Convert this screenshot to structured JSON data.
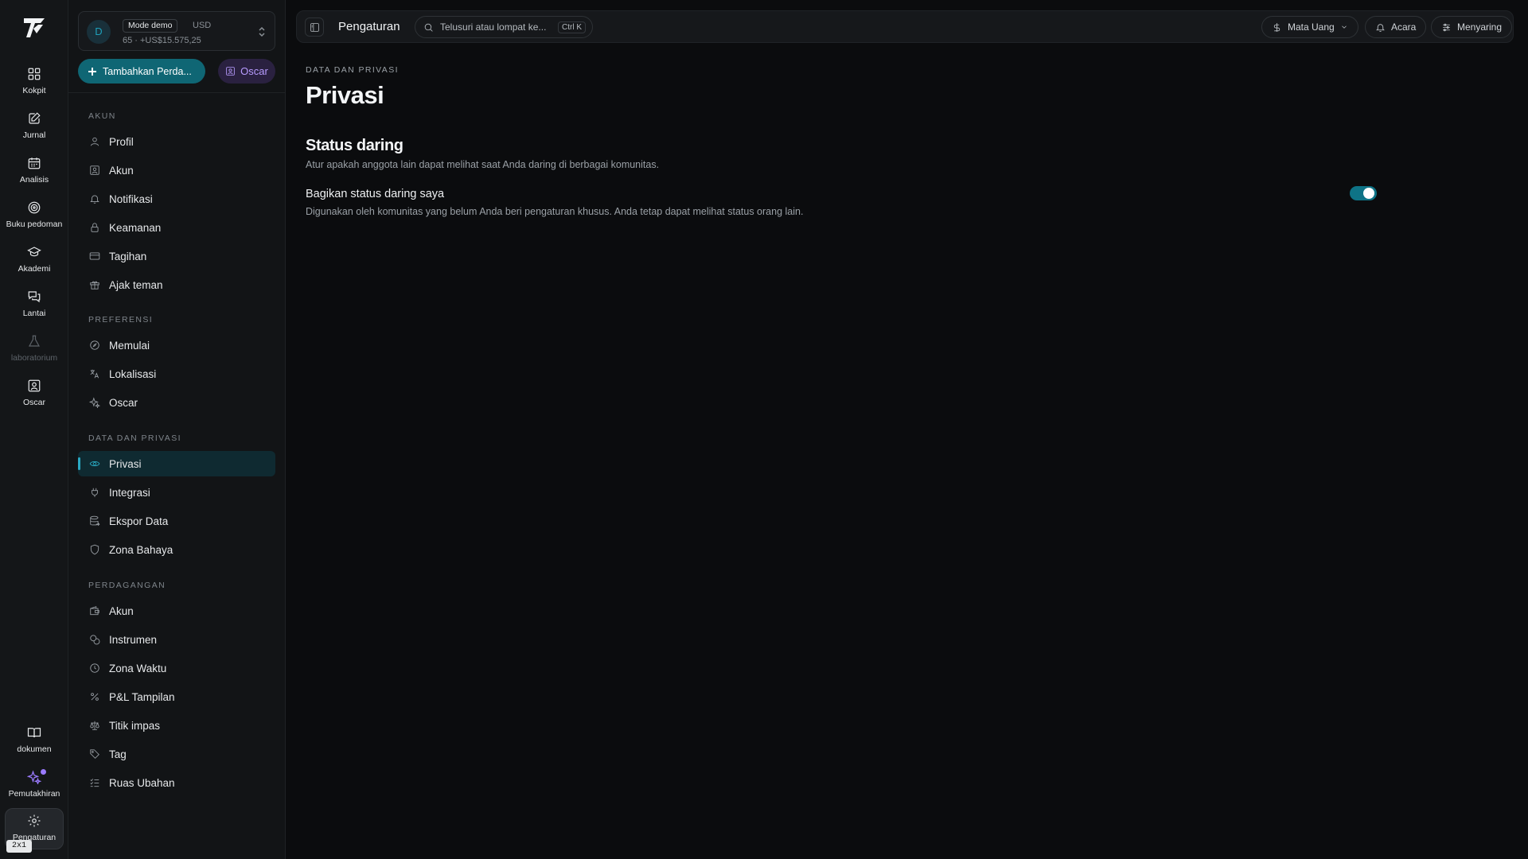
{
  "colors": {
    "accent": "#0f6674",
    "accent_bright": "#2aa8c2",
    "oscar_purple": "#b89cff",
    "background": "#0b0c0e",
    "sidebar": "#121416"
  },
  "rail": {
    "items": [
      {
        "label": "Kokpit",
        "icon": "dashboard-grid-icon"
      },
      {
        "label": "Jurnal",
        "icon": "journal-edit-icon"
      },
      {
        "label": "Analisis",
        "icon": "calendar-analysis-icon"
      },
      {
        "label": "Buku pedoman",
        "icon": "target-icon"
      },
      {
        "label": "Akademi",
        "icon": "graduation-cap-icon"
      },
      {
        "label": "Lantai",
        "icon": "chat-bubbles-icon"
      },
      {
        "label": "laboratorium",
        "icon": "flask-icon"
      },
      {
        "label": "Oscar",
        "icon": "oscar-portrait-icon"
      }
    ],
    "bottom": [
      {
        "label": "dokumen",
        "icon": "book-open-icon"
      },
      {
        "label": "Pemutakhiran",
        "icon": "sparkles-icon"
      },
      {
        "label": "Pengaturan",
        "icon": "gear-icon"
      }
    ],
    "shortcut_badge": "2x1"
  },
  "account": {
    "avatar_letter": "D",
    "mode_badge": "Mode demo",
    "currency": "USD",
    "balance": "65 · +US$15.575,25"
  },
  "actions": {
    "add_label": "Tambahkan Perda...",
    "oscar_label": "Oscar"
  },
  "sections": [
    {
      "title": "AKUN",
      "items": [
        {
          "label": "Profil",
          "icon": "user-icon"
        },
        {
          "label": "Akun",
          "icon": "id-card-icon"
        },
        {
          "label": "Notifikasi",
          "icon": "bell-icon"
        },
        {
          "label": "Keamanan",
          "icon": "lock-icon"
        },
        {
          "label": "Tagihan",
          "icon": "credit-card-icon"
        },
        {
          "label": "Ajak teman",
          "icon": "gift-icon"
        }
      ]
    },
    {
      "title": "PREFERENSI",
      "items": [
        {
          "label": "Memulai",
          "icon": "compass-icon"
        },
        {
          "label": "Lokalisasi",
          "icon": "translate-icon"
        },
        {
          "label": "Oscar",
          "icon": "sparkles-icon"
        }
      ]
    },
    {
      "title": "DATA DAN PRIVASI",
      "items": [
        {
          "label": "Privasi",
          "icon": "eye-icon"
        },
        {
          "label": "Integrasi",
          "icon": "plug-icon"
        },
        {
          "label": "Ekspor Data",
          "icon": "database-export-icon"
        },
        {
          "label": "Zona Bahaya",
          "icon": "shield-icon"
        }
      ]
    },
    {
      "title": "PERDAGANGAN",
      "items": [
        {
          "label": "Akun",
          "icon": "wallet-icon"
        },
        {
          "label": "Instrumen",
          "icon": "coins-icon"
        },
        {
          "label": "Zona Waktu",
          "icon": "clock-icon"
        },
        {
          "label": "P&L Tampilan",
          "icon": "percent-icon"
        },
        {
          "label": "Titik impas",
          "icon": "scale-icon"
        },
        {
          "label": "Tag",
          "icon": "tag-icon"
        },
        {
          "label": "Ruas Ubahan",
          "icon": "list-check-icon"
        }
      ]
    }
  ],
  "topbar": {
    "title": "Pengaturan",
    "search_placeholder": "Telusuri atau lompat ke...",
    "search_shortcut": "Ctrl K",
    "currency_label": "Mata Uang",
    "events_label": "Acara",
    "filter_label": "Menyaring"
  },
  "main": {
    "breadcrumb": "DATA DAN PRIVASI",
    "title": "Privasi",
    "section_heading": "Status daring",
    "section_desc": "Atur apakah anggota lain dapat melihat saat Anda daring di berbagai komunitas.",
    "setting_label": "Bagikan status daring saya",
    "setting_desc": "Digunakan oleh komunitas yang belum Anda beri pengaturan khusus. Anda tetap dapat melihat status orang lain.",
    "share_online_status": true
  }
}
